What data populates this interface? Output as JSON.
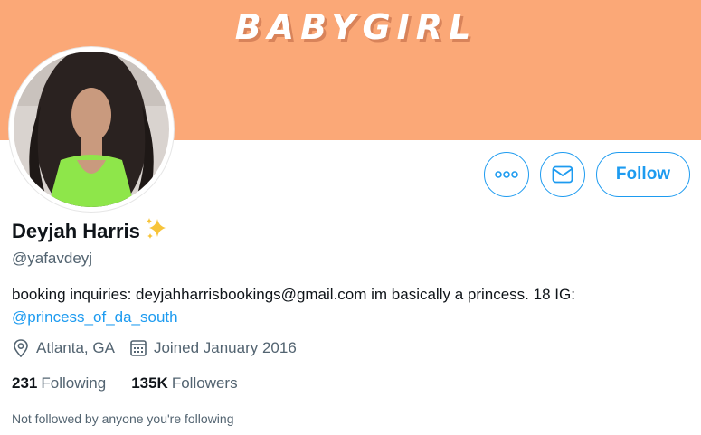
{
  "banner": {
    "text": "BABYGIRL",
    "color": "#fba877"
  },
  "profile": {
    "name": "Deyjah Harris",
    "name_emoji": "sparkles-icon",
    "handle": "@yafavdeyj",
    "bio_text": "booking inquiries: deyjahharrisbookings@gmail.com im basically a princess. 18 IG: ",
    "bio_link": "@princess_of_da_south",
    "location": "Atlanta, GA",
    "joined": "Joined January 2016"
  },
  "actions": {
    "more_icon": "more-icon",
    "message_icon": "mail-icon",
    "follow_label": "Follow"
  },
  "stats": {
    "following_count": "231",
    "following_label": "Following",
    "followers_count": "135K",
    "followers_label": "Followers"
  },
  "followed_by": "Not followed by anyone you're following",
  "colors": {
    "accent": "#1d9bf0",
    "secondary_text": "#536471",
    "primary_text": "#0f1419"
  }
}
